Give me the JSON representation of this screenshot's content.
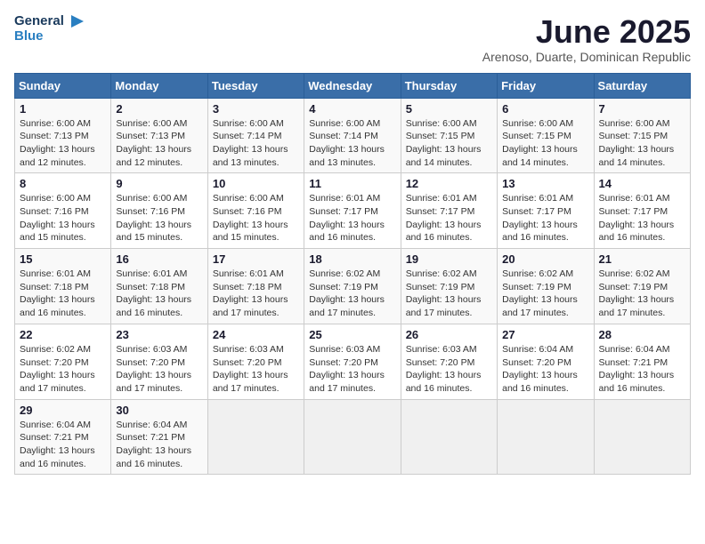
{
  "header": {
    "logo_line1": "General",
    "logo_line2": "Blue",
    "month": "June 2025",
    "location": "Arenoso, Duarte, Dominican Republic"
  },
  "weekdays": [
    "Sunday",
    "Monday",
    "Tuesday",
    "Wednesday",
    "Thursday",
    "Friday",
    "Saturday"
  ],
  "weeks": [
    [
      {
        "day": "1",
        "info": "Sunrise: 6:00 AM\nSunset: 7:13 PM\nDaylight: 13 hours\nand 12 minutes."
      },
      {
        "day": "2",
        "info": "Sunrise: 6:00 AM\nSunset: 7:13 PM\nDaylight: 13 hours\nand 12 minutes."
      },
      {
        "day": "3",
        "info": "Sunrise: 6:00 AM\nSunset: 7:14 PM\nDaylight: 13 hours\nand 13 minutes."
      },
      {
        "day": "4",
        "info": "Sunrise: 6:00 AM\nSunset: 7:14 PM\nDaylight: 13 hours\nand 13 minutes."
      },
      {
        "day": "5",
        "info": "Sunrise: 6:00 AM\nSunset: 7:15 PM\nDaylight: 13 hours\nand 14 minutes."
      },
      {
        "day": "6",
        "info": "Sunrise: 6:00 AM\nSunset: 7:15 PM\nDaylight: 13 hours\nand 14 minutes."
      },
      {
        "day": "7",
        "info": "Sunrise: 6:00 AM\nSunset: 7:15 PM\nDaylight: 13 hours\nand 14 minutes."
      }
    ],
    [
      {
        "day": "8",
        "info": "Sunrise: 6:00 AM\nSunset: 7:16 PM\nDaylight: 13 hours\nand 15 minutes."
      },
      {
        "day": "9",
        "info": "Sunrise: 6:00 AM\nSunset: 7:16 PM\nDaylight: 13 hours\nand 15 minutes."
      },
      {
        "day": "10",
        "info": "Sunrise: 6:00 AM\nSunset: 7:16 PM\nDaylight: 13 hours\nand 15 minutes."
      },
      {
        "day": "11",
        "info": "Sunrise: 6:01 AM\nSunset: 7:17 PM\nDaylight: 13 hours\nand 16 minutes."
      },
      {
        "day": "12",
        "info": "Sunrise: 6:01 AM\nSunset: 7:17 PM\nDaylight: 13 hours\nand 16 minutes."
      },
      {
        "day": "13",
        "info": "Sunrise: 6:01 AM\nSunset: 7:17 PM\nDaylight: 13 hours\nand 16 minutes."
      },
      {
        "day": "14",
        "info": "Sunrise: 6:01 AM\nSunset: 7:17 PM\nDaylight: 13 hours\nand 16 minutes."
      }
    ],
    [
      {
        "day": "15",
        "info": "Sunrise: 6:01 AM\nSunset: 7:18 PM\nDaylight: 13 hours\nand 16 minutes."
      },
      {
        "day": "16",
        "info": "Sunrise: 6:01 AM\nSunset: 7:18 PM\nDaylight: 13 hours\nand 16 minutes."
      },
      {
        "day": "17",
        "info": "Sunrise: 6:01 AM\nSunset: 7:18 PM\nDaylight: 13 hours\nand 17 minutes."
      },
      {
        "day": "18",
        "info": "Sunrise: 6:02 AM\nSunset: 7:19 PM\nDaylight: 13 hours\nand 17 minutes."
      },
      {
        "day": "19",
        "info": "Sunrise: 6:02 AM\nSunset: 7:19 PM\nDaylight: 13 hours\nand 17 minutes."
      },
      {
        "day": "20",
        "info": "Sunrise: 6:02 AM\nSunset: 7:19 PM\nDaylight: 13 hours\nand 17 minutes."
      },
      {
        "day": "21",
        "info": "Sunrise: 6:02 AM\nSunset: 7:19 PM\nDaylight: 13 hours\nand 17 minutes."
      }
    ],
    [
      {
        "day": "22",
        "info": "Sunrise: 6:02 AM\nSunset: 7:20 PM\nDaylight: 13 hours\nand 17 minutes."
      },
      {
        "day": "23",
        "info": "Sunrise: 6:03 AM\nSunset: 7:20 PM\nDaylight: 13 hours\nand 17 minutes."
      },
      {
        "day": "24",
        "info": "Sunrise: 6:03 AM\nSunset: 7:20 PM\nDaylight: 13 hours\nand 17 minutes."
      },
      {
        "day": "25",
        "info": "Sunrise: 6:03 AM\nSunset: 7:20 PM\nDaylight: 13 hours\nand 17 minutes."
      },
      {
        "day": "26",
        "info": "Sunrise: 6:03 AM\nSunset: 7:20 PM\nDaylight: 13 hours\nand 16 minutes."
      },
      {
        "day": "27",
        "info": "Sunrise: 6:04 AM\nSunset: 7:20 PM\nDaylight: 13 hours\nand 16 minutes."
      },
      {
        "day": "28",
        "info": "Sunrise: 6:04 AM\nSunset: 7:21 PM\nDaylight: 13 hours\nand 16 minutes."
      }
    ],
    [
      {
        "day": "29",
        "info": "Sunrise: 6:04 AM\nSunset: 7:21 PM\nDaylight: 13 hours\nand 16 minutes."
      },
      {
        "day": "30",
        "info": "Sunrise: 6:04 AM\nSunset: 7:21 PM\nDaylight: 13 hours\nand 16 minutes."
      },
      {
        "day": "",
        "info": ""
      },
      {
        "day": "",
        "info": ""
      },
      {
        "day": "",
        "info": ""
      },
      {
        "day": "",
        "info": ""
      },
      {
        "day": "",
        "info": ""
      }
    ]
  ]
}
